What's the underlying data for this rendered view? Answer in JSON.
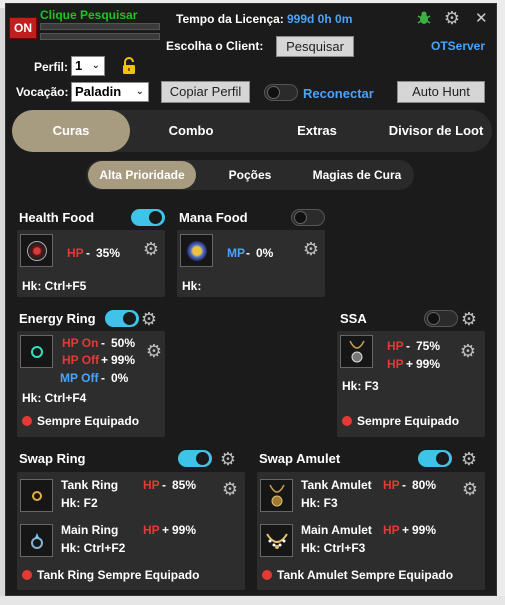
{
  "titlebar": {
    "on_label": "ON",
    "script_name": "Clique Pesquisar",
    "license_label": "Tempo da Licença:",
    "license_value": "999d 0h 0m",
    "client_label": "Escolha o Client:",
    "search_button": "Pesquisar",
    "server_name": "OTServer",
    "close_glyph": "✕"
  },
  "profile": {
    "perfil_label": "Perfil:",
    "perfil_value": "1",
    "vocacao_label": "Vocação:",
    "vocacao_value": "Paladin",
    "copy_button": "Copiar Perfil",
    "reconnect_label": "Reconectar",
    "auto_hunt_button": "Auto Hunt"
  },
  "main_tabs": [
    {
      "label": "Curas",
      "active": true
    },
    {
      "label": "Combo",
      "active": false
    },
    {
      "label": "Extras",
      "active": false
    },
    {
      "label": "Divisor de Loot",
      "active": false
    }
  ],
  "sub_tabs": [
    {
      "label": "Alta Prioridade",
      "active": true
    },
    {
      "label": "Poções",
      "active": false
    },
    {
      "label": "Magias de Cura",
      "active": false
    }
  ],
  "health_food": {
    "title": "Health Food",
    "enabled": true,
    "cond": "HP",
    "op": "-",
    "value": "35%",
    "hotkey": "Hk: Ctrl+F5"
  },
  "mana_food": {
    "title": "Mana Food",
    "enabled": false,
    "cond": "MP",
    "op": "-",
    "value": "0%",
    "hotkey": "Hk:"
  },
  "energy_ring": {
    "title": "Energy Ring",
    "enabled": true,
    "hp_on": "HP On",
    "hp_on_op": "-",
    "hp_on_value": "50%",
    "hp_off": "HP Off",
    "hp_off_op": "+",
    "hp_off_value": "99%",
    "mp_off": "MP Off",
    "mp_off_op": "-",
    "mp_off_value": "0%",
    "hotkey": "Hk: Ctrl+F4",
    "always": "Sempre Equipado"
  },
  "ssa": {
    "title": "SSA",
    "enabled": false,
    "cond1": "HP",
    "op1": "-",
    "value1": "75%",
    "cond2": "HP",
    "op2": "+",
    "value2": "99%",
    "hotkey": "Hk: F3",
    "always": "Sempre Equipado"
  },
  "swap_ring": {
    "title": "Swap Ring",
    "enabled": true,
    "tank_name": "Tank Ring",
    "tank_cond": "HP",
    "tank_op": "-",
    "tank_value": "85%",
    "tank_hotkey": "Hk: F2",
    "main_name": "Main Ring",
    "main_cond": "HP",
    "main_op": "+",
    "main_value": "99%",
    "main_hotkey": "Hk: Ctrl+F2",
    "always": "Tank Ring Sempre Equipado"
  },
  "swap_amulet": {
    "title": "Swap Amulet",
    "enabled": true,
    "tank_name": "Tank Amulet",
    "tank_cond": "HP",
    "tank_op": "-",
    "tank_value": "80%",
    "tank_hotkey": "Hk: F3",
    "main_name": "Main Amulet",
    "main_cond": "HP",
    "main_op": "+",
    "main_value": "99%",
    "main_hotkey": "Hk: Ctrl+F3",
    "always": "Tank Amulet Sempre Equipado"
  },
  "colors": {
    "accent": "#3fc3e8",
    "tab_active": "#a89c80",
    "hp": "#e53935",
    "mp": "#4aa3ff",
    "script_green": "#1ec51e"
  },
  "icons": [
    "bug-icon",
    "gear-icon",
    "close-icon",
    "lock-icon",
    "chevron-down-icon"
  ]
}
